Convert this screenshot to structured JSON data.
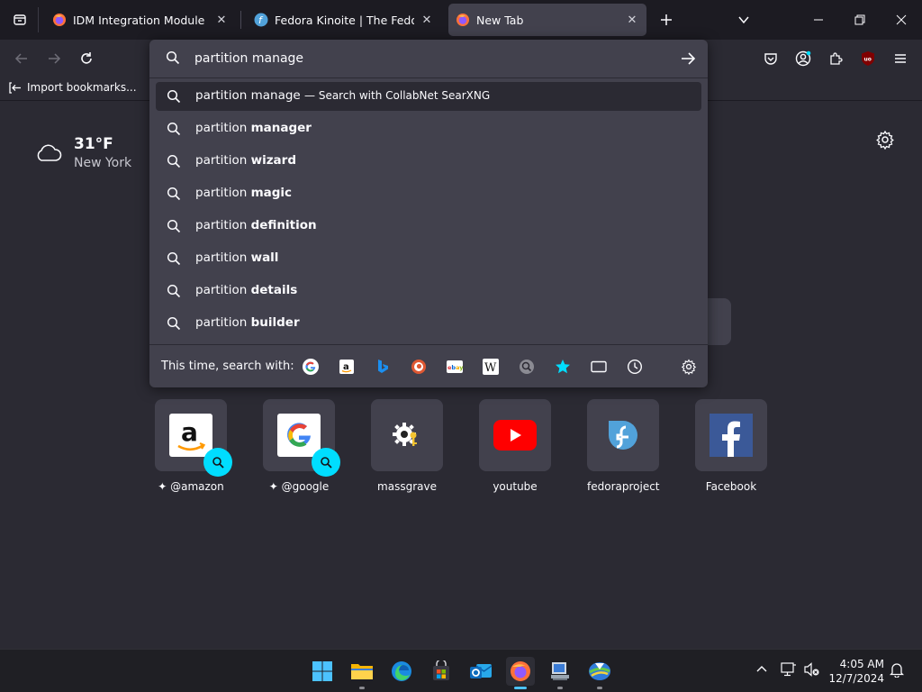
{
  "tabs": [
    {
      "title": "IDM Integration Module – Get t",
      "active": false,
      "icon": "firefox-icon"
    },
    {
      "title": "Fedora Kinoite | The Fedora Pro",
      "active": false,
      "icon": "fedora-icon"
    },
    {
      "title": "New Tab",
      "active": true,
      "icon": "firefox-icon"
    }
  ],
  "bookmarks": {
    "import_label": "Import bookmarks..."
  },
  "urlbar": {
    "value": "partition manage",
    "first": {
      "typed": "partition manage",
      "action": "— Search with CollabNet SearXNG"
    },
    "suggestions": [
      {
        "prefix": "partition ",
        "bold": "manager"
      },
      {
        "prefix": "partition ",
        "bold": "wizard"
      },
      {
        "prefix": "partition ",
        "bold": "magic"
      },
      {
        "prefix": "partition ",
        "bold": "definition"
      },
      {
        "prefix": "partition ",
        "bold": "wall"
      },
      {
        "prefix": "partition ",
        "bold": "details"
      },
      {
        "prefix": "partition ",
        "bold": "builder"
      }
    ],
    "one_off_label": "This time, search with:",
    "engines": [
      "google-icon",
      "amazon-icon",
      "bing-icon",
      "duckduckgo-icon",
      "ebay-icon",
      "wikipedia-icon",
      "searxng-icon",
      "bookmarks-icon",
      "tabs-icon",
      "history-icon"
    ]
  },
  "weather": {
    "temp": "31°F",
    "city": "New York"
  },
  "shortcuts": [
    {
      "label": "@amazon",
      "sponsored_marker": true
    },
    {
      "label": "@google",
      "sponsored_marker": true
    },
    {
      "label": "massgrave"
    },
    {
      "label": "youtube"
    },
    {
      "label": "fedoraproject"
    },
    {
      "label": "Facebook"
    }
  ],
  "taskbar": {
    "time": "4:05 AM",
    "date": "12/7/2024"
  },
  "colors": {
    "accent": "#00ddff",
    "panel": "#42414d",
    "background": "#2b2a33",
    "tabstrip": "#1c1b22"
  }
}
